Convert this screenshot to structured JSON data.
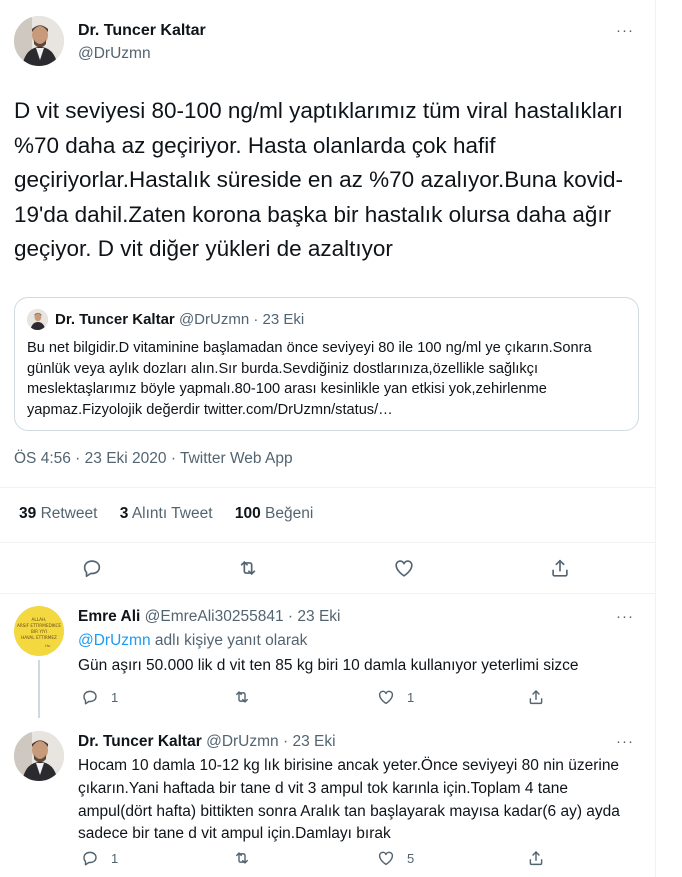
{
  "main_tweet": {
    "author_name": "Dr. Tuncer Kaltar",
    "author_handle": "@DrUzmn",
    "more_icon": "···",
    "text": "D vit seviyesi 80-100 ng/ml yaptıklarımız tüm viral hastalıkları %70 daha az geçiriyor. Hasta olanlarda çok hafif geçiriyorlar.Hastalık süreside en az %70 azalıyor.Buna kovid-19'da dahil.Zaten korona başka bir hastalık olursa daha ağır geçiyor. D vit diğer yükleri de azaltıyor",
    "quote": {
      "author_name": "Dr. Tuncer Kaltar",
      "author_handle": "@DrUzmn",
      "separator": "·",
      "date": "23 Eki",
      "text": "Bu net bilgidir.D vitaminine başlamadan önce seviyeyi 80 ile 100 ng/ml ye çıkarın.Sonra günlük veya aylık dozları alın.Sır burda.Sevdiğiniz dostlarınıza,özellikle sağlıkçı meslektaşlarımız böyle yapmalı.80-100 arası kesinlikle yan etkisi yok,zehirlenme yapmaz.Fizyolojik değerdir twitter.com/DrUzmn/status/…"
    },
    "meta": "ÖS 4:56 · 23 Eki 2020 · Twitter Web App",
    "stats": {
      "retweets_count": "39",
      "retweets_label": "Retweet",
      "quotes_count": "3",
      "quotes_label": "Alıntı Tweet",
      "likes_count": "100",
      "likes_label": "Beğeni"
    },
    "actions": [
      "reply-icon",
      "retweet-icon",
      "like-icon",
      "share-icon"
    ]
  },
  "replies": [
    {
      "author_name": "Emre Ali",
      "author_handle": "@EmreAli30255841",
      "separator": "·",
      "date": "23 Eki",
      "reply_to_mention": "@DrUzmn",
      "reply_to_suffix": " adlı kişiye yanıt olarak",
      "text": "Gün aşırı 50.000 lik d vit  ten 85 kg biri 10 damla kullanıyor yeterlimi sizce",
      "reply_count": "1",
      "retweet_count": "",
      "like_count": "1",
      "avatar_text": "ALLAH, ARSIF ETTIRMEDIKCE BIR YIYI HAVAL ETTIRMEZ"
    },
    {
      "author_name": "Dr. Tuncer Kaltar",
      "author_handle": "@DrUzmn",
      "separator": "·",
      "date": "23 Eki",
      "text": "Hocam 10 damla 10-12 kg lık birisine ancak yeter.Önce seviyeyi 80 nin üzerine çıkarın.Yani haftada bir tane d vit 3 ampul tok karınla için.Toplam 4 tane ampul(dört hafta) bittikten sonra Aralık tan başlayarak mayısa kadar(6 ay) ayda sadece bir tane d vit ampul için.Damlayı bırak",
      "reply_count": "1",
      "retweet_count": "",
      "like_count": "5"
    }
  ],
  "colors": {
    "text": "#0f1419",
    "muted": "#536471",
    "accent": "#1d9bf0",
    "border": "#cfd9de",
    "divider": "#eff3f4"
  }
}
